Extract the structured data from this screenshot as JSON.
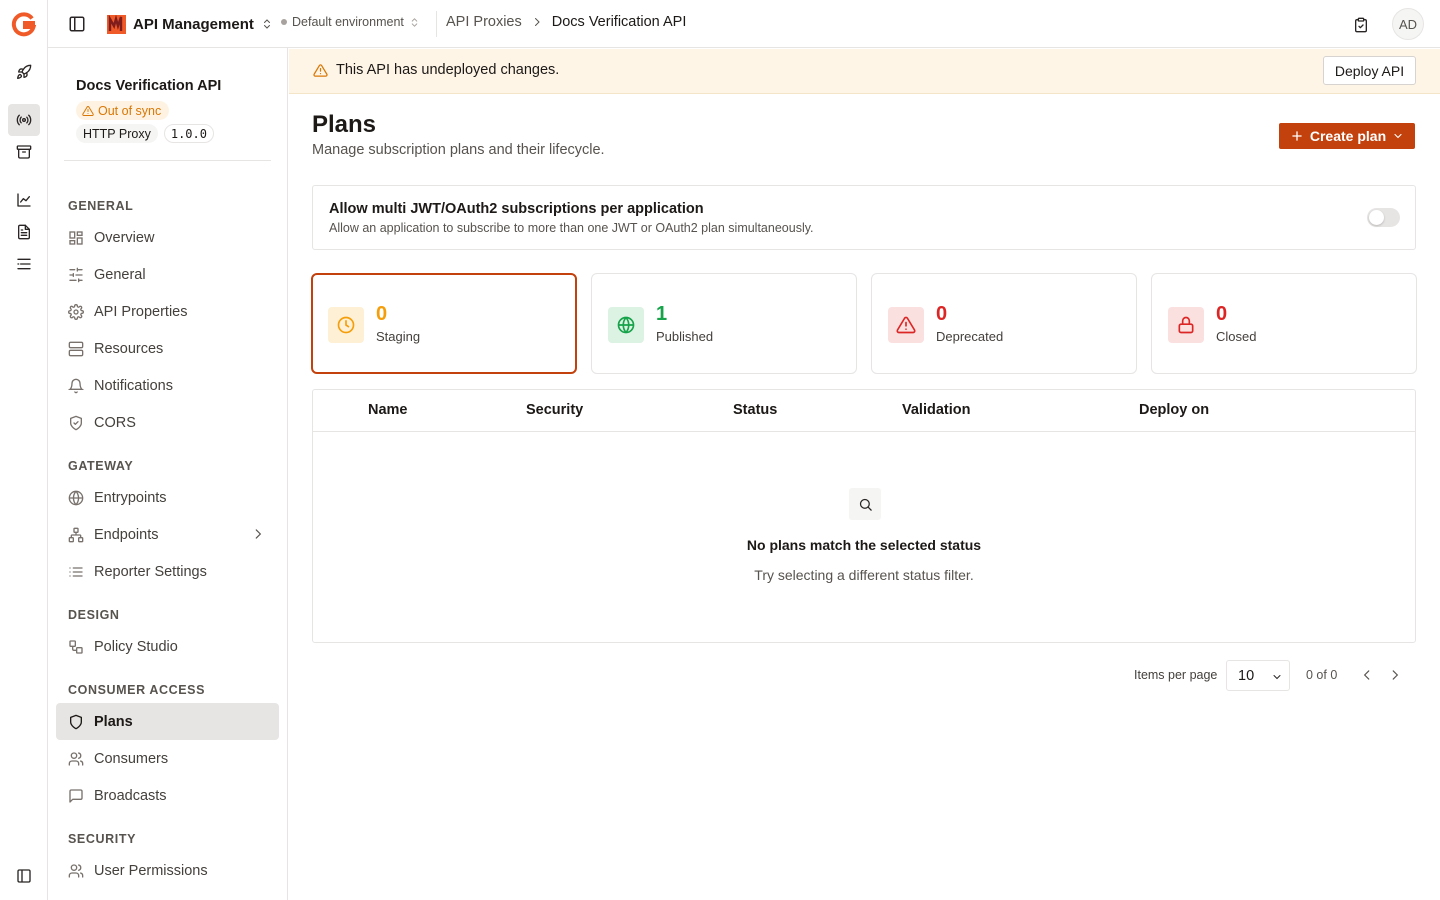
{
  "topbar": {
    "app_name": "API Management",
    "environment": "Default environment",
    "breadcrumb": [
      "API Proxies",
      "Docs Verification API"
    ],
    "avatar_initials": "AD"
  },
  "api": {
    "name": "Docs Verification API",
    "sync_status": "Out of sync",
    "type": "HTTP Proxy",
    "version": "1.0.0"
  },
  "sidenav": {
    "sections": {
      "general": "GENERAL",
      "gateway": "GATEWAY",
      "design": "DESIGN",
      "consumer_access": "CONSUMER ACCESS",
      "security": "SECURITY"
    },
    "items": {
      "overview": "Overview",
      "general": "General",
      "api_properties": "API Properties",
      "resources": "Resources",
      "notifications": "Notifications",
      "cors": "CORS",
      "entrypoints": "Entrypoints",
      "endpoints": "Endpoints",
      "reporter_settings": "Reporter Settings",
      "policy_studio": "Policy Studio",
      "plans": "Plans",
      "consumers": "Consumers",
      "broadcasts": "Broadcasts",
      "user_permissions": "User Permissions"
    }
  },
  "banner": {
    "message": "This API has undeployed changes.",
    "action": "Deploy API"
  },
  "page": {
    "title": "Plans",
    "subtitle": "Manage subscription plans and their lifecycle.",
    "create_button": "Create plan"
  },
  "multi_sub": {
    "title": "Allow multi JWT/OAuth2 subscriptions per application",
    "description": "Allow an application to subscribe to more than one JWT or OAuth2 plan simultaneously.",
    "enabled": false
  },
  "stats": {
    "staging": {
      "count": "0",
      "label": "Staging",
      "color": "#f59e0b"
    },
    "published": {
      "count": "1",
      "label": "Published",
      "color": "#16a34a"
    },
    "deprecated": {
      "count": "0",
      "label": "Deprecated",
      "color": "#dc2626"
    },
    "closed": {
      "count": "0",
      "label": "Closed",
      "color": "#dc2626"
    }
  },
  "table": {
    "columns": [
      "Name",
      "Security",
      "Status",
      "Validation",
      "Deploy on"
    ],
    "empty_title": "No plans match the selected status",
    "empty_subtitle": "Try selecting a different status filter."
  },
  "pagination": {
    "items_per_page_label": "Items per page",
    "items_per_page": "10",
    "range": "0 of 0"
  },
  "colors": {
    "accent": "#c2410c",
    "banner_bg": "#fef5e7",
    "warning": "#d97706"
  }
}
